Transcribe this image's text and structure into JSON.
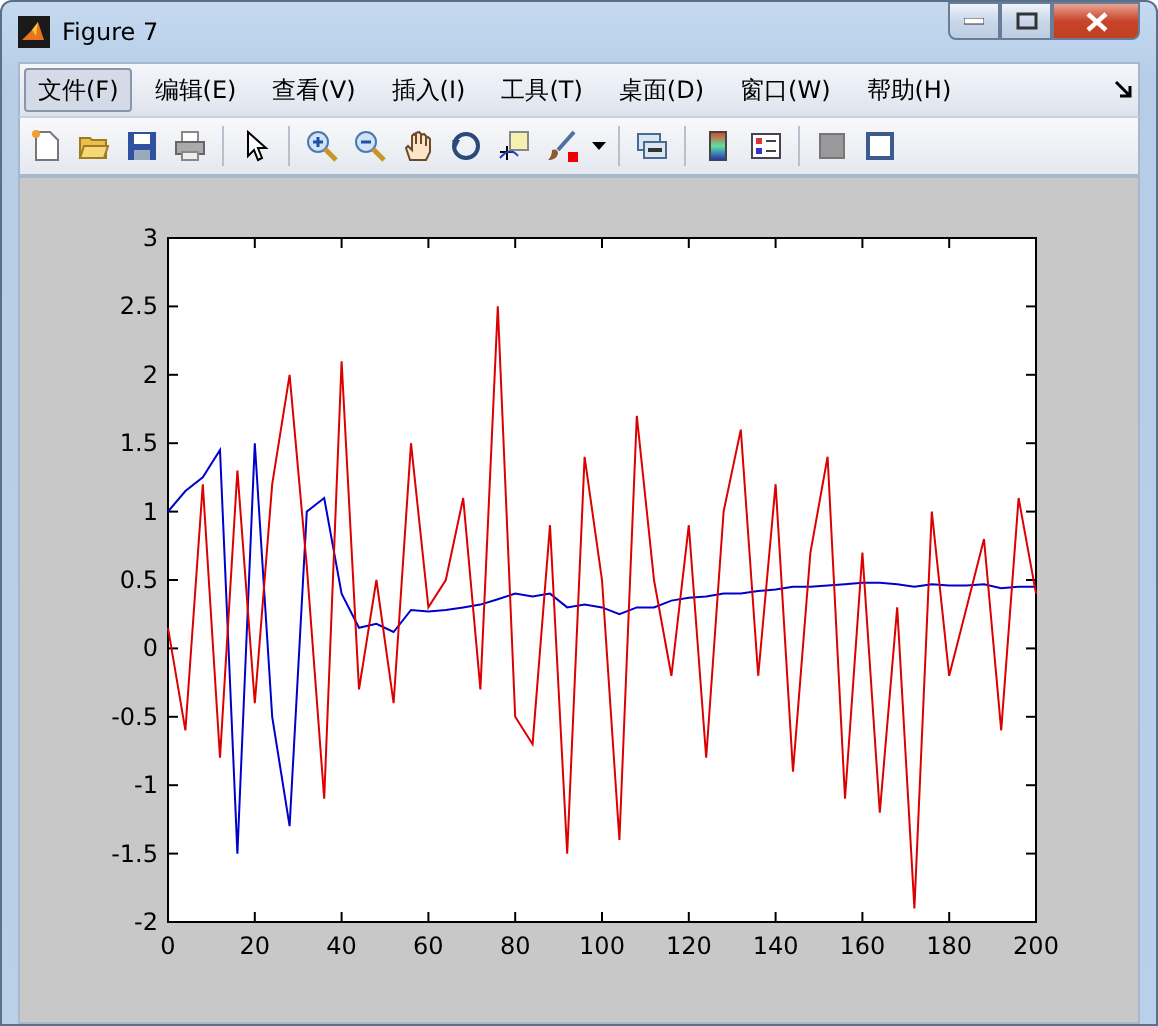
{
  "window": {
    "title": "Figure 7"
  },
  "menu": [
    {
      "label": "文件(F)",
      "selected": true
    },
    {
      "label": "编辑(E)",
      "selected": false
    },
    {
      "label": "查看(V)",
      "selected": false
    },
    {
      "label": "插入(I)",
      "selected": false
    },
    {
      "label": "工具(T)",
      "selected": false
    },
    {
      "label": "桌面(D)",
      "selected": false
    },
    {
      "label": "窗口(W)",
      "selected": false
    },
    {
      "label": "帮助(H)",
      "selected": false
    }
  ],
  "figure": {
    "chart_data": {
      "type": "line",
      "xlim": [
        0,
        200
      ],
      "ylim": [
        -2,
        3
      ],
      "xticks": [
        0,
        20,
        40,
        60,
        80,
        100,
        120,
        140,
        160,
        180,
        200
      ],
      "yticks": [
        -2,
        -1.5,
        -1,
        -0.5,
        0,
        0.5,
        1,
        1.5,
        2,
        2.5,
        3
      ],
      "x": [
        0,
        4,
        8,
        12,
        16,
        20,
        24,
        28,
        32,
        36,
        40,
        44,
        48,
        52,
        56,
        60,
        64,
        68,
        72,
        76,
        80,
        84,
        88,
        92,
        96,
        100,
        104,
        108,
        112,
        116,
        120,
        124,
        128,
        132,
        136,
        140,
        144,
        148,
        152,
        156,
        160,
        164,
        168,
        172,
        176,
        180,
        184,
        188,
        192,
        196,
        200
      ],
      "series": [
        {
          "color": "#0000cc",
          "values": [
            1.0,
            1.15,
            1.25,
            1.45,
            -1.5,
            1.5,
            -0.5,
            -1.3,
            1.0,
            1.1,
            0.4,
            0.15,
            0.18,
            0.12,
            0.28,
            0.27,
            0.28,
            0.3,
            0.32,
            0.36,
            0.4,
            0.38,
            0.4,
            0.3,
            0.32,
            0.3,
            0.25,
            0.3,
            0.3,
            0.35,
            0.37,
            0.38,
            0.4,
            0.4,
            0.42,
            0.43,
            0.45,
            0.45,
            0.46,
            0.47,
            0.48,
            0.48,
            0.47,
            0.45,
            0.47,
            0.46,
            0.46,
            0.47,
            0.44,
            0.45,
            0.45
          ]
        },
        {
          "color": "#dd0000",
          "values": [
            0.15,
            -0.6,
            1.2,
            -0.8,
            1.3,
            -0.4,
            1.2,
            2.0,
            0.6,
            -1.1,
            2.1,
            -0.3,
            0.5,
            -0.4,
            1.5,
            0.3,
            0.5,
            1.1,
            -0.3,
            2.5,
            -0.5,
            -0.7,
            0.9,
            -1.5,
            1.4,
            0.5,
            -1.4,
            1.7,
            0.5,
            -0.2,
            0.9,
            -0.8,
            1.0,
            1.6,
            -0.2,
            1.2,
            -0.9,
            0.7,
            1.4,
            -1.1,
            0.7,
            -1.2,
            0.3,
            -1.9,
            1.0,
            -0.2,
            0.3,
            0.8,
            -0.6,
            1.1,
            0.4
          ]
        }
      ]
    }
  }
}
